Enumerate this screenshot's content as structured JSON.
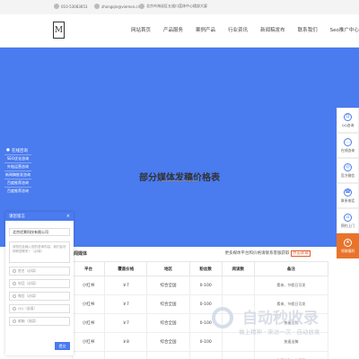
{
  "topbar": {
    "phone": "010-53083653",
    "email": "zhongqin@viemon.cn",
    "address": "北京市海淀区五道口蓝体中心楼部大厦"
  },
  "header": {
    "logo_letter": "M",
    "nav": [
      "网站首页",
      "产品服务",
      "案例产品",
      "行业资讯",
      "新闻稿发布",
      "联系我们",
      "Seo推广中心"
    ]
  },
  "hero": {
    "title": "部分媒体发稿价格表"
  },
  "left_service": {
    "title": "在线咨询",
    "items": [
      "SEO优化咨询",
      "外链运营咨询",
      "新闻稿推发咨询",
      "百度推荐咨询",
      "百度推荐咨询"
    ]
  },
  "subbar": {
    "lead": "闻媒体",
    "more_text": "更多媒体平台和价格请联系客服获取",
    "more_link": "点击获取"
  },
  "table": {
    "headers": [
      "平台",
      "覆盖价格",
      "地区",
      "粉丝数",
      "阅读数",
      "备注"
    ],
    "rows": [
      [
        "小红书",
        "￥7",
        "综合全国",
        "0-100",
        "",
        "素来、节假日可发"
      ],
      [
        "小红书",
        "￥7",
        "综合全国",
        "0-100",
        "",
        "素来、节假日可发"
      ],
      [
        "小红书",
        "￥7",
        "综合全国",
        "0-100",
        "",
        "快速出稿"
      ],
      [
        "小红书",
        "￥8",
        "综合全国",
        "0-100",
        "",
        "快速出稿"
      ],
      [
        "",
        "",
        "",
        "",
        "",
        "快速出稿，节假日"
      ]
    ]
  },
  "consult": {
    "title": "请您留言",
    "close": "×",
    "company": "北京优景科技有限公司",
    "message_placeholder": "请您在此输入您的咨询内容，我们会尽快和您联系！（必填）",
    "name_placeholder": "姓名（必填）",
    "phone_placeholder": "电话（必填）",
    "wechat_placeholder": "微信（必填）",
    "qq_placeholder": "QQ（选填）",
    "email_placeholder": "邮箱（选填）",
    "submit": "提交"
  },
  "right_tools": [
    {
      "icon": "qq-icon",
      "label": "QQ咨询"
    },
    {
      "icon": "chat-icon",
      "label": "在线咨询"
    },
    {
      "icon": "wechat-icon",
      "label": "官方微信"
    },
    {
      "icon": "phone-icon",
      "label": "联系电话"
    },
    {
      "icon": "location-icon",
      "label": "预约上门"
    },
    {
      "icon": "gift-icon",
      "label": "领取福利"
    }
  ],
  "watermark": {
    "text": "自动秒收录",
    "sub": "做上精神 · 来访一次 · 自动收录"
  },
  "colors": {
    "brand_blue": "#4a7bef",
    "accent_orange": "#e8742b"
  }
}
